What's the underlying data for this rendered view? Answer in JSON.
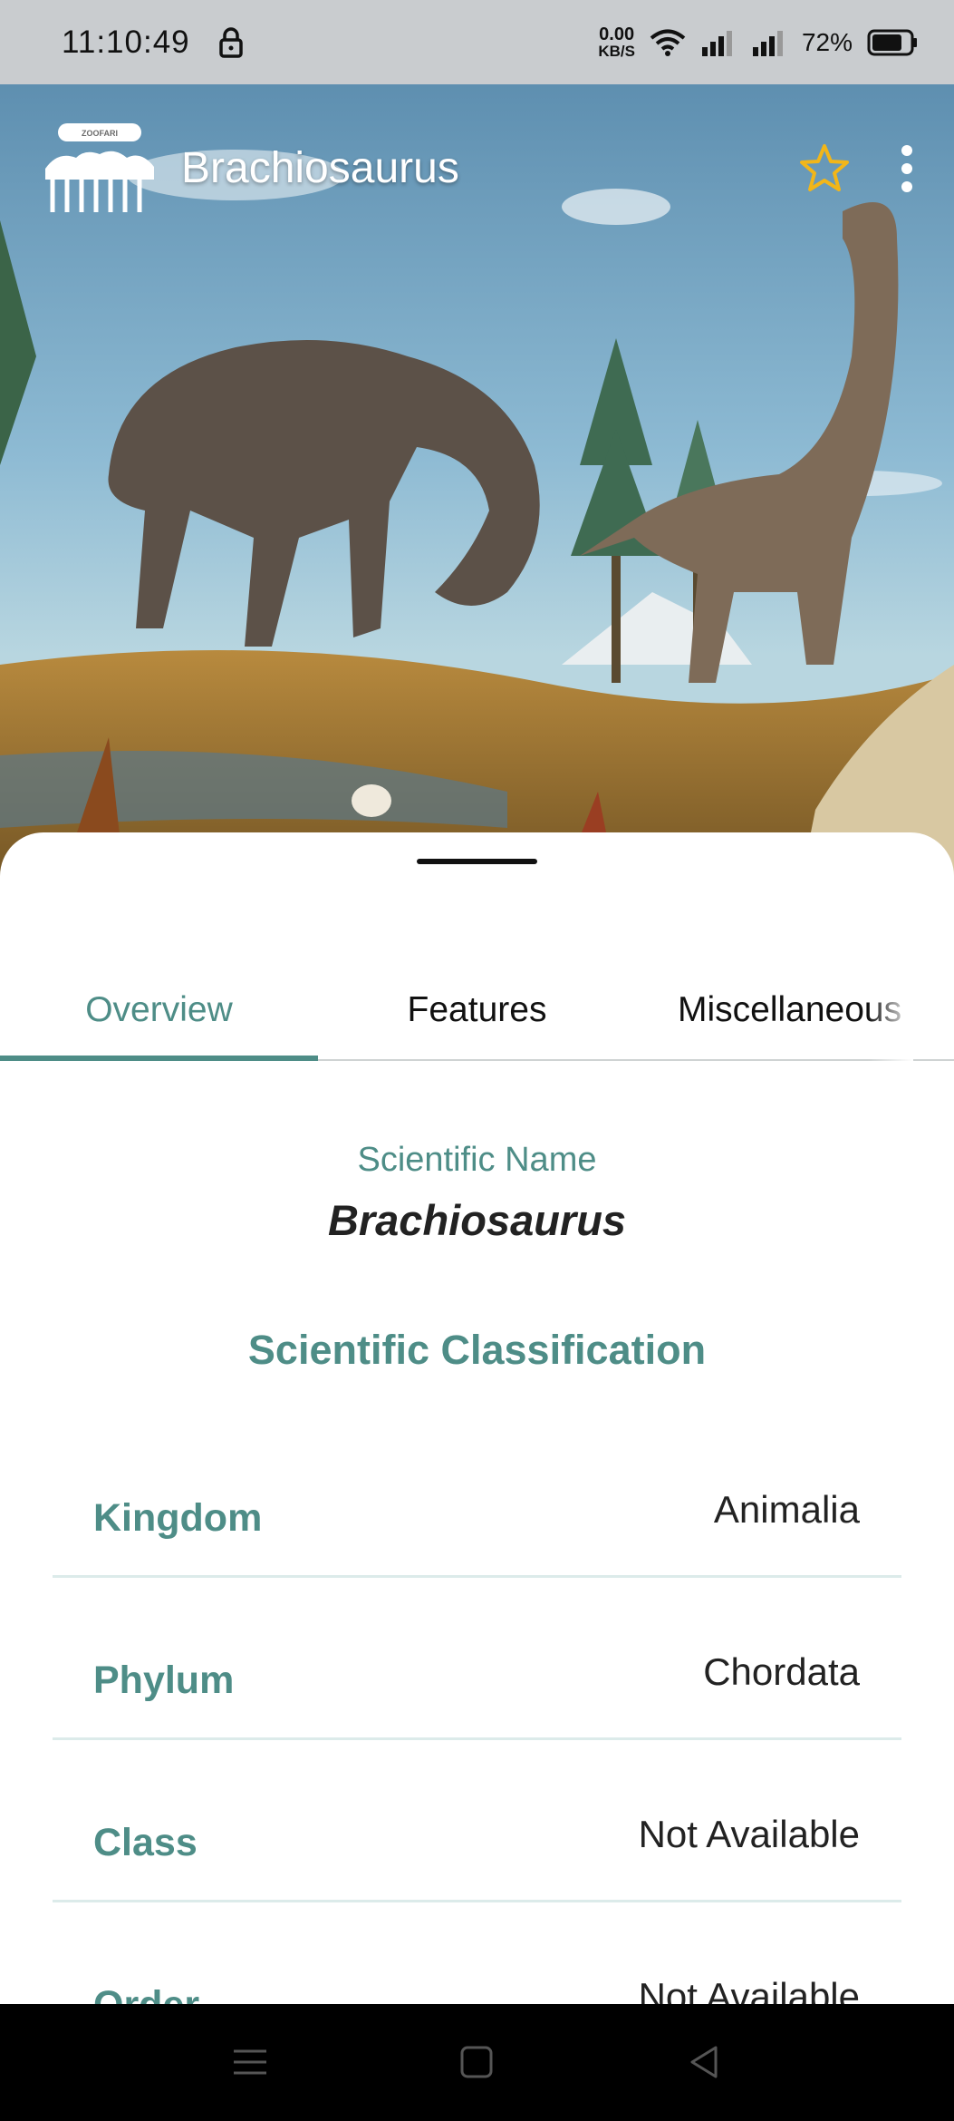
{
  "status_bar": {
    "time": "11:10:49",
    "net_speed_value": "0.00",
    "net_speed_unit": "KB/S",
    "battery": "72%"
  },
  "app_bar": {
    "title": "Brachiosaurus",
    "logo_text": "ZOOFARI"
  },
  "tabs": [
    {
      "label": "Overview",
      "active": true
    },
    {
      "label": "Features",
      "active": false
    },
    {
      "label": "Miscellaneous",
      "active": false
    }
  ],
  "overview": {
    "scientific_name_label": "Scientific Name",
    "scientific_name": "Brachiosaurus",
    "classification_title": "Scientific Classification",
    "classification": [
      {
        "key": "Kingdom",
        "value": "Animalia"
      },
      {
        "key": "Phylum",
        "value": "Chordata"
      },
      {
        "key": "Class",
        "value": "Not Available"
      },
      {
        "key": "Order",
        "value": "Not Available"
      }
    ]
  },
  "colors": {
    "accent": "#4e8d87",
    "star": "#f2b619",
    "status_bar_bg": "#c9cccf"
  },
  "icons": [
    "lock-icon",
    "wifi-icon",
    "signal-icon",
    "battery-icon",
    "star-icon",
    "more-vert-icon",
    "menu-icon",
    "home-icon",
    "back-icon"
  ]
}
